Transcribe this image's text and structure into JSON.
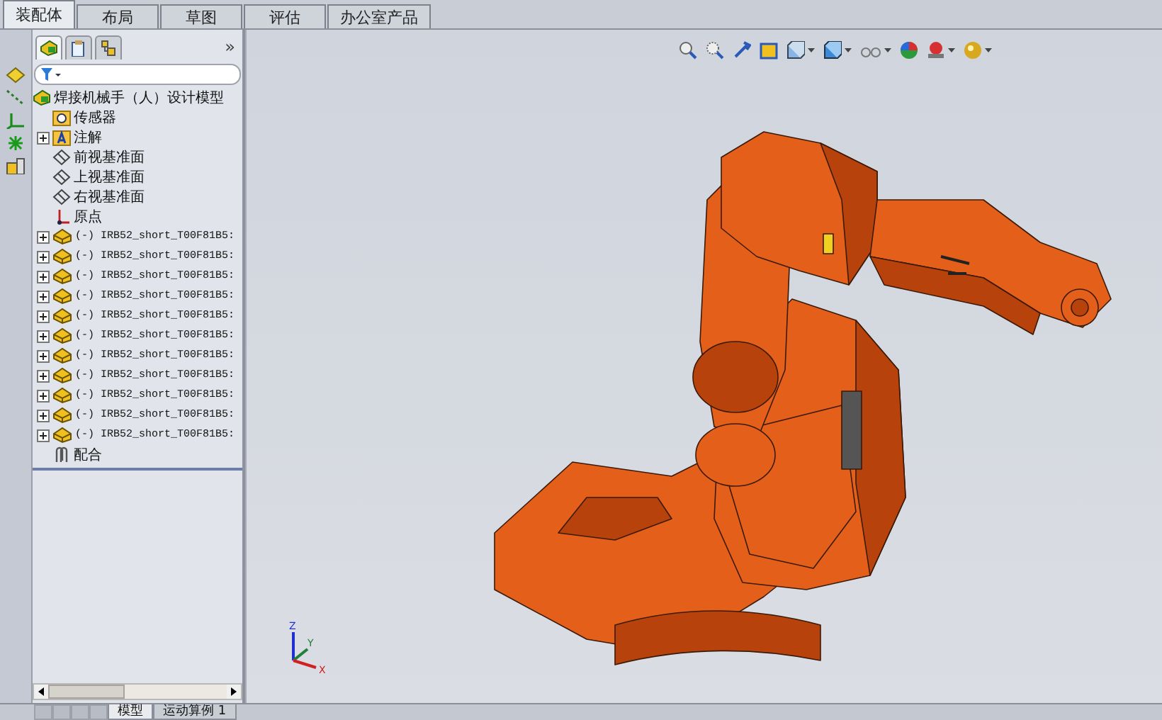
{
  "command_tabs": [
    {
      "label": "装配体",
      "selected": true
    },
    {
      "label": "布局",
      "selected": false
    },
    {
      "label": "草图",
      "selected": false
    },
    {
      "label": "评估",
      "selected": false
    },
    {
      "label": "办公室产品",
      "selected": false
    }
  ],
  "panel_tabs": [
    {
      "kind": "tree",
      "selected": true
    },
    {
      "kind": "property",
      "selected": false
    },
    {
      "kind": "config",
      "selected": false
    }
  ],
  "panel_expand": "»",
  "tree": {
    "label": "焊接机械手（人）设计模型",
    "children": [
      {
        "kind": "sensor",
        "label": "传感器",
        "expandable": false
      },
      {
        "kind": "annotation",
        "label": "注解",
        "expandable": true
      },
      {
        "kind": "plane",
        "label": "前视基准面",
        "expandable": false
      },
      {
        "kind": "plane",
        "label": "上视基准面",
        "expandable": false
      },
      {
        "kind": "plane",
        "label": "右视基准面",
        "expandable": false
      },
      {
        "kind": "origin",
        "label": "原点",
        "expandable": false
      },
      {
        "kind": "part",
        "label": "(-) IRB52_short_T00F81B5:",
        "expandable": true
      },
      {
        "kind": "part",
        "label": "(-) IRB52_short_T00F81B5:",
        "expandable": true
      },
      {
        "kind": "part",
        "label": "(-) IRB52_short_T00F81B5:",
        "expandable": true
      },
      {
        "kind": "part",
        "label": "(-) IRB52_short_T00F81B5:",
        "expandable": true
      },
      {
        "kind": "part",
        "label": "(-) IRB52_short_T00F81B5:",
        "expandable": true
      },
      {
        "kind": "part",
        "label": "(-) IRB52_short_T00F81B5:",
        "expandable": true
      },
      {
        "kind": "part",
        "label": "(-) IRB52_short_T00F81B5:",
        "expandable": true
      },
      {
        "kind": "part",
        "label": "(-) IRB52_short_T00F81B5:",
        "expandable": true
      },
      {
        "kind": "part",
        "label": "(-) IRB52_short_T00F81B5:",
        "expandable": true
      },
      {
        "kind": "part",
        "label": "(-) IRB52_short_T00F81B5:",
        "expandable": true
      },
      {
        "kind": "part",
        "label": "(-) IRB52_short_T00F81B5:",
        "expandable": true
      },
      {
        "kind": "mates",
        "label": "配合",
        "expandable": false
      }
    ]
  },
  "bottom_tabs": [
    {
      "label": "模型",
      "selected": true
    },
    {
      "label": "运动算例 1",
      "selected": false
    }
  ],
  "axes": {
    "x": "X",
    "y": "Y",
    "z": "Z"
  }
}
